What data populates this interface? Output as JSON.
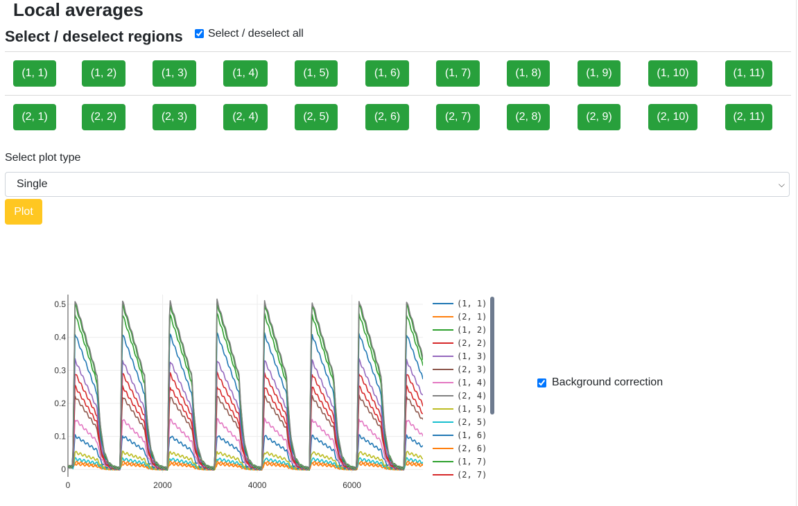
{
  "page_title": "Local averages",
  "select_title": "Select / deselect regions",
  "select_all_label": "Select / deselect all",
  "select_all_checked": true,
  "regions_row1": [
    "(1, 1)",
    "(1, 2)",
    "(1, 3)",
    "(1, 4)",
    "(1, 5)",
    "(1, 6)",
    "(1, 7)",
    "(1, 8)",
    "(1, 9)",
    "(1, 10)",
    "(1, 11)"
  ],
  "regions_row2": [
    "(2, 1)",
    "(2, 2)",
    "(2, 3)",
    "(2, 4)",
    "(2, 5)",
    "(2, 6)",
    "(2, 7)",
    "(2, 8)",
    "(2, 9)",
    "(2, 10)",
    "(2, 11)"
  ],
  "plot_type_label": "Select plot type",
  "plot_type_value": "Single",
  "plot_button_label": "Plot",
  "background_correction_label": "Background correction",
  "background_correction_checked": true,
  "colors": {
    "region_button": "#28a03c",
    "plot_button": "#ffc721"
  },
  "chart_data": {
    "type": "line",
    "title": "",
    "xlabel": "",
    "ylabel": "",
    "xlim": [
      0,
      7500
    ],
    "ylim": [
      -0.01,
      0.54
    ],
    "x_ticks": [
      0,
      2000,
      4000,
      6000
    ],
    "y_ticks": [
      0,
      0.1,
      0.2,
      0.3,
      0.4,
      0.5
    ],
    "y_tick_labels": [
      "0",
      "0.1",
      "0.2",
      "0.3",
      "0.4",
      "0.5"
    ],
    "grid": true,
    "legend_position": "right",
    "legend_scrollable": true,
    "pulse_period": 1000,
    "pulse_onsets": [
      100,
      1100,
      2100,
      3100,
      4100,
      5100,
      6100,
      7100
    ],
    "series": [
      {
        "name": "(1, 1)",
        "color": "#1f77b4",
        "peak": 0.41
      },
      {
        "name": "(2, 1)",
        "color": "#ff7f0e",
        "peak": 0.02
      },
      {
        "name": "(1, 2)",
        "color": "#2ca02c",
        "peak": 0.5
      },
      {
        "name": "(2, 2)",
        "color": "#d62728",
        "peak": 0.25
      },
      {
        "name": "(1, 3)",
        "color": "#9467bd",
        "peak": 0.33
      },
      {
        "name": "(2, 3)",
        "color": "#8c564b",
        "peak": 0.22
      },
      {
        "name": "(1, 4)",
        "color": "#e377c2",
        "peak": 0.15
      },
      {
        "name": "(2, 4)",
        "color": "#7f7f7f",
        "peak": 0.51
      },
      {
        "name": "(1, 5)",
        "color": "#bcbd22",
        "peak": 0.05
      },
      {
        "name": "(2, 5)",
        "color": "#17becf",
        "peak": 0.03
      },
      {
        "name": "(1, 6)",
        "color": "#1f77b4",
        "peak": 0.1
      },
      {
        "name": "(2, 6)",
        "color": "#ff7f0e",
        "peak": 0.015
      },
      {
        "name": "(1, 7)",
        "color": "#2ca02c",
        "peak": 0.47
      },
      {
        "name": "(2, 7)",
        "color": "#d62728",
        "peak": 0.29
      }
    ]
  }
}
